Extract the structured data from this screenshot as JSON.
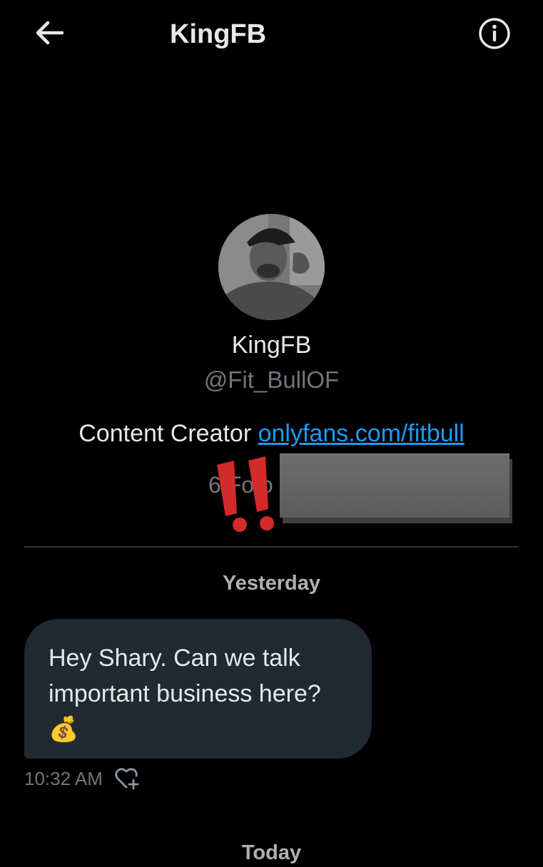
{
  "header": {
    "title": "KingFB",
    "back_icon": "arrow-left-icon",
    "info_icon": "info-icon"
  },
  "profile": {
    "name": "KingFB",
    "handle": "@Fit_BullOF",
    "bio_text": "Content Creator ",
    "bio_link": "onlyfans.com/fitbull",
    "followers_partial": "6 Fo     o"
  },
  "conversation": {
    "date_separator_1": "Yesterday",
    "message": {
      "text": "Hey Shary. Can we talk important business here?",
      "emoji": "💰",
      "time": "10:32 AM",
      "react_icon": "heart-plus-icon"
    },
    "date_separator_2": "Today"
  },
  "colors": {
    "background": "#000000",
    "text_primary": "#e7e9ea",
    "text_secondary": "#71767b",
    "link": "#1d9bf0",
    "bubble": "#212a33",
    "exclaim_red": "#d42a2a"
  }
}
